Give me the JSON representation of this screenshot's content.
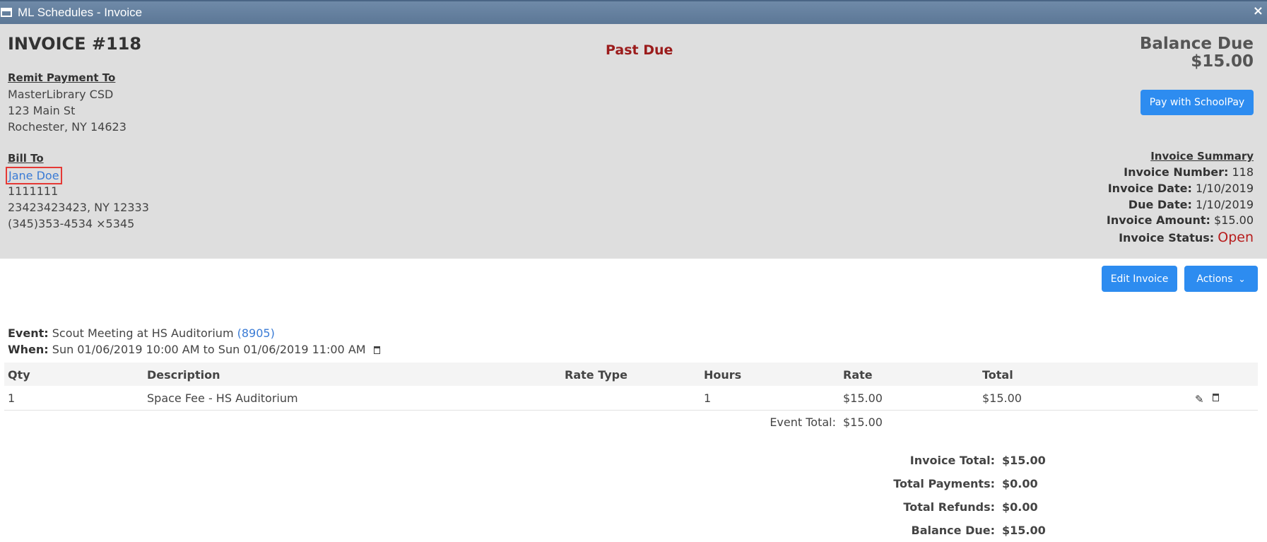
{
  "window": {
    "title": "ML Schedules - Invoice",
    "close_glyph": "×"
  },
  "invoice": {
    "title": "INVOICE #118",
    "status_banner": "Past Due",
    "balance_label": "Balance Due",
    "balance_amount": "$15.00",
    "pay_button": "Pay with SchoolPay"
  },
  "remit": {
    "heading": "Remit Payment To",
    "lines": [
      "MasterLibrary CSD",
      "123 Main St",
      "Rochester, NY 14623"
    ]
  },
  "bill_to": {
    "heading": "Bill To",
    "name": "Jane Doe",
    "lines": [
      "1111111",
      "23423423423, NY 12333",
      "(345)353-4534 ×5345"
    ]
  },
  "summary": {
    "heading": "Invoice Summary",
    "rows": [
      {
        "label": "Invoice Number:",
        "value": "118"
      },
      {
        "label": "Invoice Date:",
        "value": "1/10/2019"
      },
      {
        "label": "Due Date:",
        "value": "1/10/2019"
      },
      {
        "label": "Invoice Amount:",
        "value": "$15.00"
      },
      {
        "label": "Invoice Status:",
        "value": "Open"
      }
    ]
  },
  "toolbar": {
    "edit_label": "Edit Invoice",
    "actions_label": "Actions"
  },
  "event": {
    "event_label": "Event:",
    "event_name": "Scout Meeting at HS Auditorium",
    "event_id": "(8905)",
    "when_label": "When:",
    "when_value": "Sun 01/06/2019 10:00 AM to Sun 01/06/2019 11:00 AM"
  },
  "table": {
    "headers": [
      "Qty",
      "Description",
      "Rate Type",
      "Hours",
      "Rate",
      "Total"
    ],
    "rows": [
      {
        "qty": "1",
        "description": "Space Fee - HS Auditorium",
        "rate_type": "",
        "hours": "1",
        "rate": "$15.00",
        "total": "$15.00"
      }
    ],
    "event_total_label": "Event Total:",
    "event_total_value": "$15.00"
  },
  "totals": [
    {
      "label": "Invoice Total:",
      "value": "$15.00"
    },
    {
      "label": "Total Payments:",
      "value": "$0.00"
    },
    {
      "label": "Total Refunds:",
      "value": "$0.00"
    },
    {
      "label": "Balance Due:",
      "value": "$15.00"
    }
  ],
  "icons": [
    "window-icon",
    "close-icon",
    "trash-icon",
    "pencil-icon",
    "chevron-down-icon"
  ],
  "colors": {
    "titlebar": "#5c7796",
    "header_bg": "#dedede",
    "accent": "#2d8cf0",
    "link": "#3a7bd5",
    "alert": "#9b1c1c"
  }
}
